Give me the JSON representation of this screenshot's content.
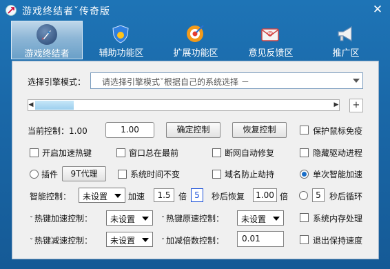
{
  "window": {
    "title": "游戏终结者ˇ传奇版",
    "close_glyph": "✕"
  },
  "tabs": [
    {
      "label": "游戏终结者",
      "icon": "rocket-icon",
      "active": true
    },
    {
      "label": "辅助功能区",
      "icon": "shield-icon",
      "active": false
    },
    {
      "label": "扩展功能区",
      "icon": "target-icon",
      "active": false
    },
    {
      "label": "意见反馈区",
      "icon": "mail-icon",
      "active": false
    },
    {
      "label": "推广区",
      "icon": "megaphone-icon",
      "active": false
    }
  ],
  "engine": {
    "label": "选择引擎模式：",
    "combo_value": "请选择引擎模式ˇ根据自己的系统选择 －"
  },
  "slider": {
    "left_arrow": "◀",
    "right_arrow": "▶",
    "plus": "+",
    "fill_fraction": 0.13
  },
  "control": {
    "current_label": "当前控制：1.00",
    "value_box": "1.00",
    "confirm_button": "确定控制",
    "restore_button": "恢复控制",
    "protect_mouse": "保护鼠标免疫"
  },
  "row3": {
    "hotkey_accel": "开启加速热键",
    "window_top": "窗口总在最前",
    "net_repair": "断网自动修复",
    "hide_driver": "隐藏驱动进程"
  },
  "row4": {
    "plugin": "插件",
    "proxy_button": "9T代理",
    "time_fixed": "系统时间不变",
    "domain_protect": "域名防止劫持",
    "single_accel": "单次智能加速"
  },
  "row5": {
    "smart_label": "智能控制：",
    "smart_select": "未设置",
    "accel_label": "加速",
    "accel_value": "1.5",
    "times_label": "倍",
    "seconds_value": "5",
    "restore_label": "秒后恢复",
    "restore_value": "1.00",
    "times_label2": "倍",
    "loop_value": "5",
    "loop_label": "秒后循环"
  },
  "row6": {
    "caret": "ˇ",
    "hotkey_accel_label": "热键加速控制：",
    "hotkey_accel_select": "未设置",
    "hotkey_restore_label": "热键原速控制：",
    "hotkey_restore_select": "未设置",
    "mem_process": "系统内存处理"
  },
  "row7": {
    "caret": "ˇ",
    "hotkey_decel_label": "热键减速控制：",
    "hotkey_decel_select": "未设置",
    "multiplier_label": "加减倍数控制：",
    "multiplier_value": "0.01",
    "exit_keep": "退出保持速度"
  },
  "colors": {
    "title_bg": "#1a68a8",
    "panel_bg": "#f0f0f0",
    "accent": "#1a4fd8"
  }
}
